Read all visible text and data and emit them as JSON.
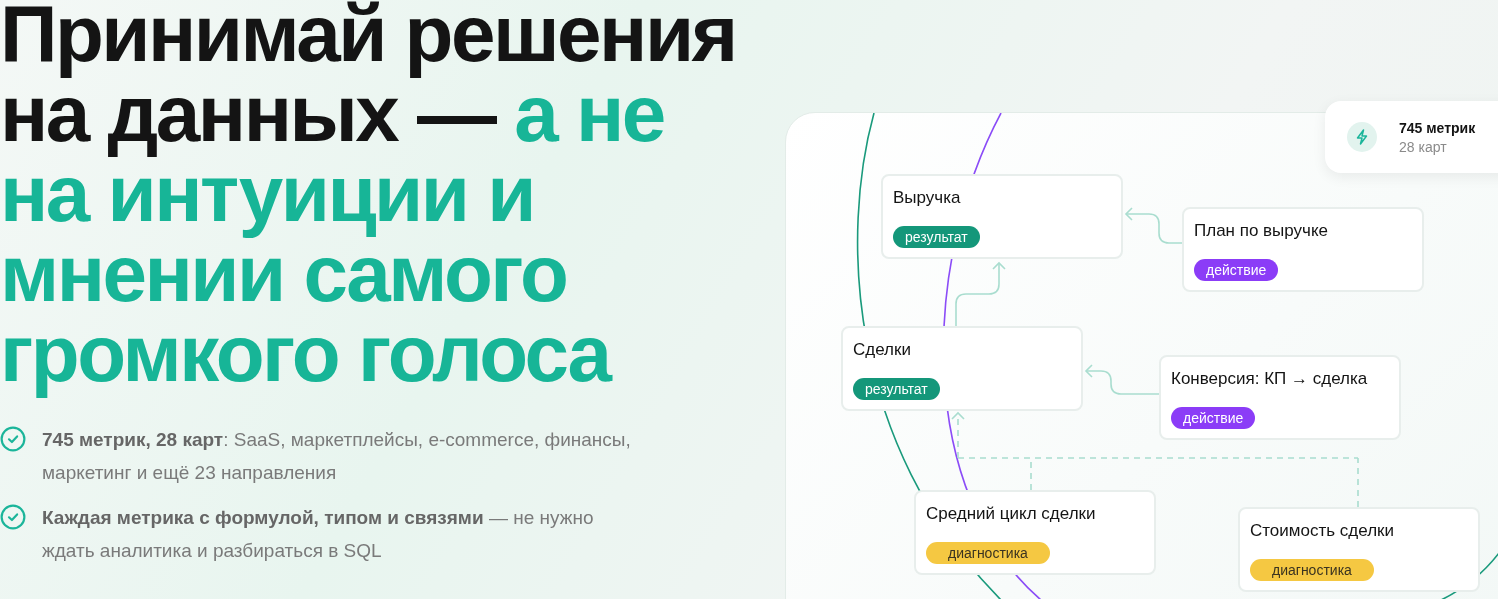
{
  "headline": {
    "lines": [
      {
        "parts": [
          {
            "text": "Принимай решения",
            "accent": false
          }
        ]
      },
      {
        "parts": [
          {
            "text": "на данных — ",
            "accent": false
          },
          {
            "text": "а не",
            "accent": true
          }
        ]
      },
      {
        "parts": [
          {
            "text": "на интуиции и",
            "accent": true
          }
        ]
      },
      {
        "parts": [
          {
            "text": "мнении самого",
            "accent": true
          }
        ]
      },
      {
        "parts": [
          {
            "text": "громкого голоса",
            "accent": true
          }
        ]
      }
    ]
  },
  "bullets": [
    {
      "text": "**745 метрик, 28 карт**: SaaS, маркетплейсы, e-commerce, финансы, маркетинг и ещё 23 направления"
    },
    {
      "text": "**Каждая метрика с формулой, типом и связями** — не нужно ждать аналитика и разбираться в SQL"
    }
  ],
  "stat_card": {
    "title": "745 метрик",
    "subtitle": "28 карт"
  },
  "nodes": [
    {
      "title": "Выручка",
      "tag": "результат",
      "kind": "result"
    },
    {
      "title": "План по выручке",
      "tag": "действие",
      "kind": "action"
    },
    {
      "title": "Сделки",
      "tag": "результат",
      "kind": "result"
    },
    {
      "title": "Конверсия: КП → сделка",
      "tag": "действие",
      "kind": "action"
    },
    {
      "title": "Средний цикл сделки",
      "tag": "диагностика",
      "kind": "diagnostic"
    },
    {
      "title": "Стоимость сделки",
      "tag": "диагностика",
      "kind": "diagnostic"
    }
  ]
}
